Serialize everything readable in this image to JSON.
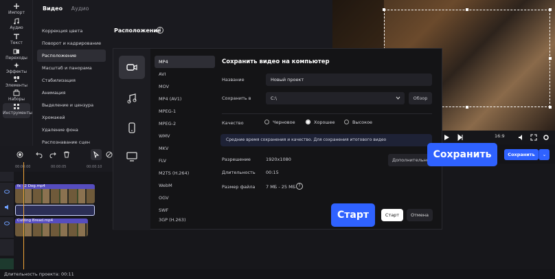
{
  "rail": {
    "items": [
      {
        "label": "Импорт",
        "icon": "plus-icon"
      },
      {
        "label": "Аудио",
        "icon": "music-icon"
      },
      {
        "label": "Текст",
        "icon": "text-icon"
      },
      {
        "label": "Переходы",
        "icon": "transitions-icon"
      },
      {
        "label": "Эффекты",
        "icon": "effects-icon"
      },
      {
        "label": "Элементы",
        "icon": "elements-icon"
      },
      {
        "label": "Наборы",
        "icon": "sets-icon"
      },
      {
        "label": "Инструменты",
        "icon": "tools-icon"
      }
    ]
  },
  "panel": {
    "tabs": [
      "Видео",
      "Аудио"
    ],
    "menu": [
      "Коррекция цвета",
      "Поворот и кадрирование",
      "Расположение",
      "Масштаб и панорама",
      "Стабилизация",
      "Анимация",
      "Выделение и цензура",
      "Хромакей",
      "Удаление фона",
      "Распознавание сцен"
    ],
    "active_menu": 2,
    "section_title": "Расположение"
  },
  "player": {
    "aspect": "16:9"
  },
  "top_save": {
    "label": "Сохранить",
    "dropdown": "⌄"
  },
  "callouts": {
    "save": "Сохранить",
    "start": "Старт"
  },
  "timeline": {
    "ruler": [
      "00:00:00",
      "00:00:05",
      "00:00:10"
    ],
    "clips": [
      {
        "name": "Dog.mp4",
        "badge": "fx · 2"
      },
      {
        "name": "Cutting Bread.mp4"
      }
    ]
  },
  "status": {
    "duration": "Длительность проекта: 00:11"
  },
  "modal": {
    "title": "Сохранить видео на компьютер",
    "formats": [
      "MP4",
      "AVI",
      "MOV",
      "MP4 (AV1)",
      "MPEG-1",
      "MPEG-2",
      "WMV",
      "MKV",
      "FLV",
      "M2TS (H.264)",
      "WebM",
      "OGV",
      "SWF",
      "3GP (H.263)"
    ],
    "active_format": 0,
    "name_label": "Название",
    "name_value": "Новый проект",
    "save_in_label": "Сохранить в",
    "save_in_value": "C:\\",
    "browse": "Обзор",
    "quality_label": "Качество",
    "quality_options": [
      "Черновое",
      "Хорошее",
      "Высокое"
    ],
    "quality_selected": 1,
    "hint": "Средние время сохранения и качество. Для сохранения итогового видео",
    "resolution_label": "Разрешение",
    "resolution_value": "1920x1080",
    "more_label": "Дополнительно",
    "duration_label": "Длительность",
    "duration_value": "00:15",
    "size_label": "Размер файла",
    "size_value": "7 МБ - 25 МБ",
    "start": "Старт",
    "cancel": "Отмена"
  },
  "colors": {
    "accent": "#2f62ff",
    "playhead": "#f2a53a",
    "clip_label": "#5a50c8"
  }
}
